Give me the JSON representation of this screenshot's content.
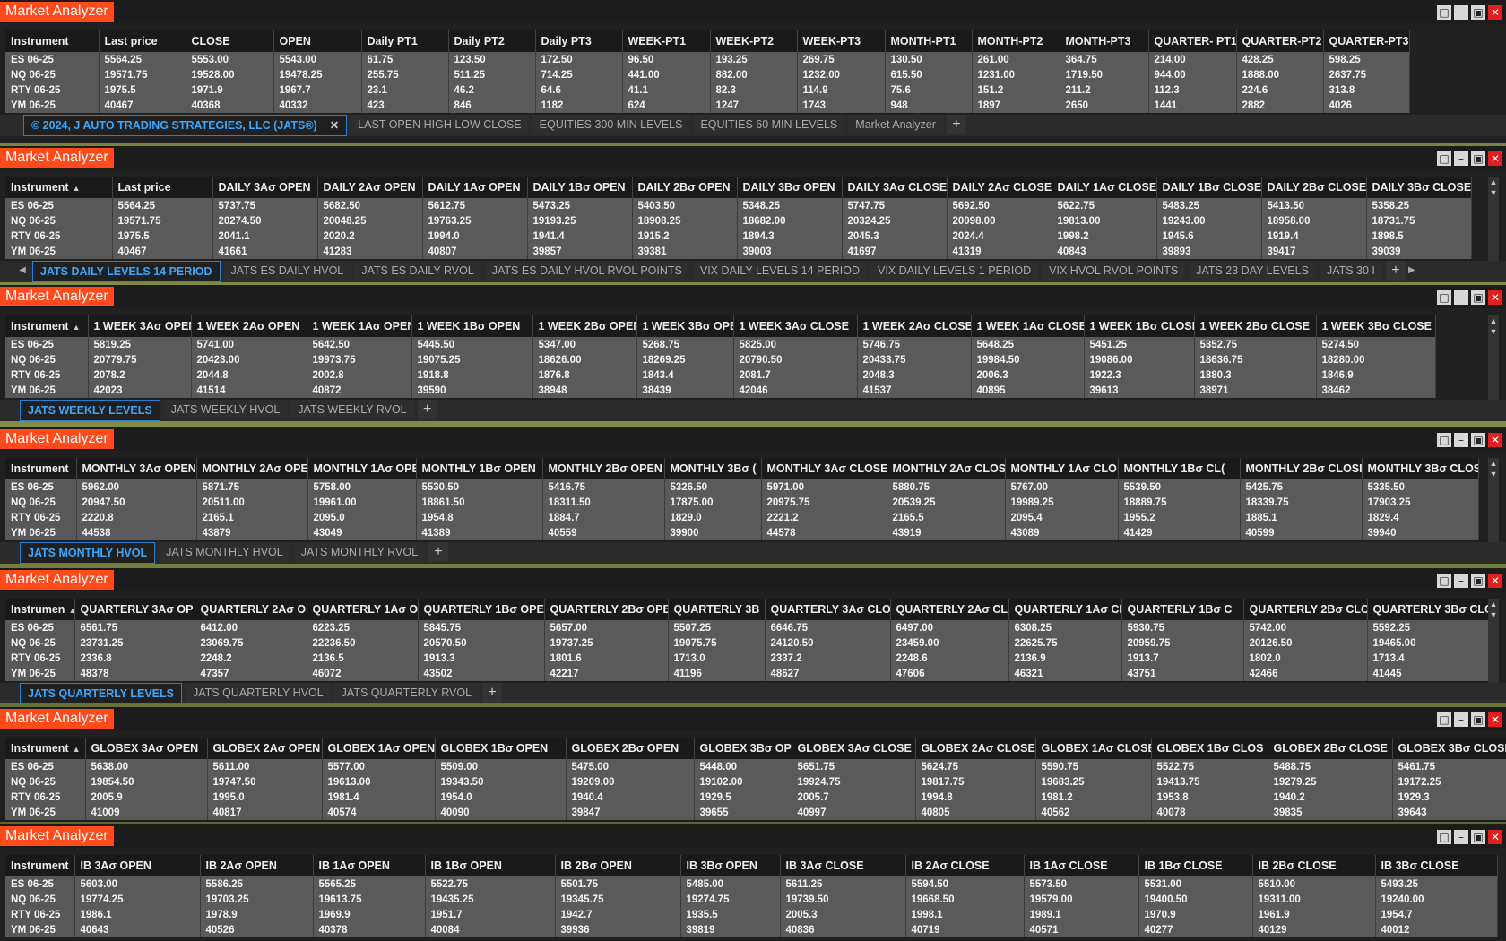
{
  "window_title": "Market Analyzer",
  "instruments": [
    "ES 06-25",
    "NQ 06-25",
    "RTY 06-25",
    "YM 06-25"
  ],
  "panels": [
    {
      "columns": [
        "Instrument",
        "Last price",
        "CLOSE",
        "OPEN",
        "Daily PT1",
        "Daily PT2",
        "Daily PT3",
        "WEEK-PT1",
        "WEEK-PT2",
        "WEEK-PT3",
        "MONTH-PT1",
        "MONTH-PT2",
        "MONTH-PT3",
        "QUARTER- PT1",
        "QUARTER-PT2",
        "QUARTER-PT3"
      ],
      "rows": [
        [
          "ES 06-25",
          "5564.25",
          "5553.00",
          "5543.00",
          "61.75",
          "123.50",
          "172.50",
          "96.50",
          "193.25",
          "269.75",
          "130.50",
          "261.00",
          "364.75",
          "214.00",
          "428.25",
          "598.25"
        ],
        [
          "NQ 06-25",
          "19571.75",
          "19528.00",
          "19478.25",
          "255.75",
          "511.25",
          "714.25",
          "441.00",
          "882.00",
          "1232.00",
          "615.50",
          "1231.00",
          "1719.50",
          "944.00",
          "1888.00",
          "2637.75"
        ],
        [
          "RTY 06-25",
          "1975.5",
          "1971.9",
          "1967.7",
          "23.1",
          "46.2",
          "64.6",
          "41.1",
          "82.3",
          "114.9",
          "75.6",
          "151.2",
          "211.2",
          "112.3",
          "224.6",
          "313.8"
        ],
        [
          "YM 06-25",
          "40467",
          "40368",
          "40332",
          "423",
          "846",
          "1182",
          "624",
          "1247",
          "1743",
          "948",
          "1897",
          "2650",
          "1441",
          "2882",
          "4026"
        ]
      ],
      "tabs": [
        "© 2024, J AUTO TRADING STRATEGIES, LLC (JATS®)",
        "LAST OPEN HIGH LOW CLOSE",
        "EQUITIES 300 MIN LEVELS",
        "EQUITIES 60 MIN LEVELS",
        "Market Analyzer"
      ]
    },
    {
      "columns": [
        "Instrument",
        "Last price",
        "DAILY 3Aσ OPEN",
        "DAILY 2Aσ OPEN",
        "DAILY 1Aσ OPEN",
        "DAILY 1Bσ OPEN",
        "DAILY 2Bσ OPEN",
        "DAILY 3Bσ OPEN",
        "DAILY 3Aσ CLOSE",
        "DAILY 2Aσ CLOSE",
        "DAILY 1Aσ CLOSE",
        "DAILY 1Bσ CLOSE",
        "DAILY 2Bσ CLOSE",
        "DAILY 3Bσ CLOSE"
      ],
      "rows": [
        [
          "ES 06-25",
          "5564.25",
          "5737.75",
          "5682.50",
          "5612.75",
          "5473.25",
          "5403.50",
          "5348.25",
          "5747.75",
          "5692.50",
          "5622.75",
          "5483.25",
          "5413.50",
          "5358.25"
        ],
        [
          "NQ 06-25",
          "19571.75",
          "20274.50",
          "20048.25",
          "19763.25",
          "19193.25",
          "18908.25",
          "18682.00",
          "20324.25",
          "20098.00",
          "19813.00",
          "19243.00",
          "18958.00",
          "18731.75"
        ],
        [
          "RTY 06-25",
          "1975.5",
          "2041.1",
          "2020.2",
          "1994.0",
          "1941.4",
          "1915.2",
          "1894.3",
          "2045.3",
          "2024.4",
          "1998.2",
          "1945.6",
          "1919.4",
          "1898.5"
        ],
        [
          "YM 06-25",
          "40467",
          "41661",
          "41283",
          "40807",
          "39857",
          "39381",
          "39003",
          "41697",
          "41319",
          "40843",
          "39893",
          "39417",
          "39039"
        ]
      ],
      "tabs": [
        "JATS DAILY LEVELS 14 PERIOD",
        "JATS ES DAILY HVOL",
        "JATS ES DAILY RVOL",
        "JATS ES DAILY HVOL RVOL POINTS",
        "VIX DAILY LEVELS 14 PERIOD",
        "VIX DAILY LEVELS 1 PERIOD",
        "VIX HVOL RVOL POINTS",
        "JATS 23 DAY LEVELS",
        "JATS 30 I"
      ]
    },
    {
      "columns": [
        "Instrument",
        "1 WEEK 3Aσ OPEN",
        "1 WEEK 2Aσ OPEN",
        "1 WEEK 1Aσ OPEN",
        "1 WEEK 1Bσ OPEN",
        "1 WEEK 2Bσ OPEN",
        "1 WEEK 3Bσ OPEN",
        "1 WEEK 3Aσ CLOSE",
        "1 WEEK 2Aσ CLOSE",
        "1 WEEK 1Aσ CLOSE",
        "1 WEEK 1Bσ CLOSE",
        "1 WEEK 2Bσ CLOSE",
        "1 WEEK 3Bσ CLOSE"
      ],
      "rows": [
        [
          "ES 06-25",
          "5819.25",
          "5741.00",
          "5642.50",
          "5445.50",
          "5347.00",
          "5268.75",
          "5825.00",
          "5746.75",
          "5648.25",
          "5451.25",
          "5352.75",
          "5274.50"
        ],
        [
          "NQ 06-25",
          "20779.75",
          "20423.00",
          "19973.75",
          "19075.25",
          "18626.00",
          "18269.25",
          "20790.50",
          "20433.75",
          "19984.50",
          "19086.00",
          "18636.75",
          "18280.00"
        ],
        [
          "RTY 06-25",
          "2078.2",
          "2044.8",
          "2002.8",
          "1918.8",
          "1876.8",
          "1843.4",
          "2081.7",
          "2048.3",
          "2006.3",
          "1922.3",
          "1880.3",
          "1846.9"
        ],
        [
          "YM 06-25",
          "42023",
          "41514",
          "40872",
          "39590",
          "38948",
          "38439",
          "42046",
          "41537",
          "40895",
          "39613",
          "38971",
          "38462"
        ]
      ],
      "tabs": [
        "JATS WEEKLY LEVELS",
        "JATS WEEKLY HVOL",
        "JATS WEEKLY RVOL"
      ]
    },
    {
      "columns": [
        "Instrument",
        "MONTHLY 3Aσ OPEN",
        "MONTHLY 2Aσ OPE",
        "MONTHLY 1Aσ OPE",
        "MONTHLY 1Bσ OPEN",
        "MONTHLY 2Bσ OPEN",
        "MONTHLY 3Bσ (",
        "MONTHLY 3Aσ CLOSE",
        "MONTHLY 2Aσ CLOS",
        "MONTHLY 1Aσ CLO:",
        "MONTHLY 1Bσ CL(",
        "MONTHLY 2Bσ CLOSI",
        "MONTHLY 3Bσ CLOSI"
      ],
      "rows": [
        [
          "ES 06-25",
          "5962.00",
          "5871.75",
          "5758.00",
          "5530.50",
          "5416.75",
          "5326.50",
          "5971.00",
          "5880.75",
          "5767.00",
          "5539.50",
          "5425.75",
          "5335.50"
        ],
        [
          "NQ 06-25",
          "20947.50",
          "20511.00",
          "19961.00",
          "18861.50",
          "18311.50",
          "17875.00",
          "20975.75",
          "20539.25",
          "19989.25",
          "18889.75",
          "18339.75",
          "17903.25"
        ],
        [
          "RTY 06-25",
          "2220.8",
          "2165.1",
          "2095.0",
          "1954.8",
          "1884.7",
          "1829.0",
          "2221.2",
          "2165.5",
          "2095.4",
          "1955.2",
          "1885.1",
          "1829.4"
        ],
        [
          "YM 06-25",
          "44538",
          "43879",
          "43049",
          "41389",
          "40559",
          "39900",
          "44578",
          "43919",
          "43089",
          "41429",
          "40599",
          "39940"
        ]
      ],
      "tabs": [
        "JATS MONTHLY HVOL",
        "JATS MONTHLY HVOL",
        "JATS MONTHLY RVOL"
      ]
    },
    {
      "columns": [
        "Instrumen",
        "QUARTERLY 3Aσ OP",
        "QUARTERLY 2Aσ OI",
        "QUARTERLY 1Aσ OI",
        "QUARTERLY 1Bσ OPEI",
        "QUARTERLY 2Bσ OPE",
        "QUARTERLY 3B",
        "QUARTERLY 3Aσ CLO",
        "QUARTERLY 2Aσ CL(",
        "QUARTERLY 1Aσ CL",
        "QUARTERLY 1Bσ C",
        "QUARTERLY 2Bσ CLC",
        "QUARTERLY 3Bσ CLC"
      ],
      "rows": [
        [
          "ES 06-25",
          "6561.75",
          "6412.00",
          "6223.25",
          "5845.75",
          "5657.00",
          "5507.25",
          "6646.75",
          "6497.00",
          "6308.25",
          "5930.75",
          "5742.00",
          "5592.25"
        ],
        [
          "NQ 06-25",
          "23731.25",
          "23069.75",
          "22236.50",
          "20570.50",
          "19737.25",
          "19075.75",
          "24120.50",
          "23459.00",
          "22625.75",
          "20959.75",
          "20126.50",
          "19465.00"
        ],
        [
          "RTY 06-25",
          "2336.8",
          "2248.2",
          "2136.5",
          "1913.3",
          "1801.6",
          "1713.0",
          "2337.2",
          "2248.6",
          "2136.9",
          "1913.7",
          "1802.0",
          "1713.4"
        ],
        [
          "YM 06-25",
          "48378",
          "47357",
          "46072",
          "43502",
          "42217",
          "41196",
          "48627",
          "47606",
          "46321",
          "43751",
          "42466",
          "41445"
        ]
      ],
      "tabs": [
        "JATS QUARTERLY LEVELS",
        "JATS QUARTERLY HVOL",
        "JATS QUARTERLY RVOL"
      ]
    },
    {
      "columns": [
        "Instrument",
        "GLOBEX 3Aσ OPEN",
        "GLOBEX 2Aσ OPEN",
        "GLOBEX 1Aσ OPEN",
        "GLOBEX 1Bσ OPEN",
        "GLOBEX 2Bσ OPEN",
        "GLOBEX 3Bσ OP",
        "GLOBEX 3Aσ CLOSE",
        "GLOBEX 2Aσ CLOSE",
        "GLOBEX 1Aσ CLOSE",
        "GLOBEX 1Bσ CLOS",
        "GLOBEX 2Bσ CLOSE",
        "GLOBEX 3Bσ CLOSE"
      ],
      "rows": [
        [
          "ES 06-25",
          "5638.00",
          "5611.00",
          "5577.00",
          "5509.00",
          "5475.00",
          "5448.00",
          "5651.75",
          "5624.75",
          "5590.75",
          "5522.75",
          "5488.75",
          "5461.75"
        ],
        [
          "NQ 06-25",
          "19854.50",
          "19747.50",
          "19613.00",
          "19343.50",
          "19209.00",
          "19102.00",
          "19924.75",
          "19817.75",
          "19683.25",
          "19413.75",
          "19279.25",
          "19172.25"
        ],
        [
          "RTY 06-25",
          "2005.9",
          "1995.0",
          "1981.4",
          "1954.0",
          "1940.4",
          "1929.5",
          "2005.7",
          "1994.8",
          "1981.2",
          "1953.8",
          "1940.2",
          "1929.3"
        ],
        [
          "YM 06-25",
          "41009",
          "40817",
          "40574",
          "40090",
          "39847",
          "39655",
          "40997",
          "40805",
          "40562",
          "40078",
          "39835",
          "39643"
        ]
      ],
      "tabs": []
    },
    {
      "columns": [
        "Instrument",
        "IB 3Aσ OPEN",
        "IB 2Aσ OPEN",
        "IB 1Aσ OPEN",
        "IB 1Bσ OPEN",
        "IB 2Bσ OPEN",
        "IB 3Bσ OPEN",
        "IB 3Aσ CLOSE",
        "IB 2Aσ CLOSE",
        "IB 1Aσ CLOSE",
        "IB 1Bσ CLOSE",
        "IB 2Bσ CLOSE",
        "IB 3Bσ CLOSE"
      ],
      "rows": [
        [
          "ES 06-25",
          "5603.00",
          "5586.25",
          "5565.25",
          "5522.75",
          "5501.75",
          "5485.00",
          "5611.25",
          "5594.50",
          "5573.50",
          "5531.00",
          "5510.00",
          "5493.25"
        ],
        [
          "NQ 06-25",
          "19774.25",
          "19703.25",
          "19613.75",
          "19435.25",
          "19345.75",
          "19274.75",
          "19739.50",
          "19668.50",
          "19579.00",
          "19400.50",
          "19311.00",
          "19240.00"
        ],
        [
          "RTY 06-25",
          "1986.1",
          "1978.9",
          "1969.9",
          "1951.7",
          "1942.7",
          "1935.5",
          "2005.3",
          "1998.1",
          "1989.1",
          "1970.9",
          "1961.9",
          "1954.7"
        ],
        [
          "YM 06-25",
          "40643",
          "40526",
          "40378",
          "40084",
          "39936",
          "39819",
          "40836",
          "40719",
          "40571",
          "40277",
          "40129",
          "40012"
        ]
      ],
      "tabs": []
    }
  ]
}
